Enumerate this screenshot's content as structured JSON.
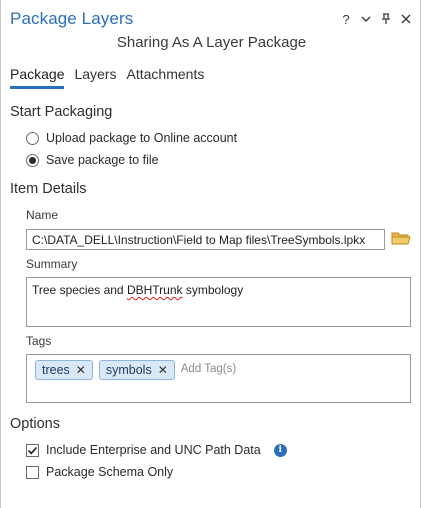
{
  "pane": {
    "title": "Package Layers",
    "controls": {
      "help": "?",
      "menu": "⌄",
      "pin": "⊥",
      "close": "✕"
    },
    "subtitle": "Sharing As A Layer Package"
  },
  "tabs": [
    {
      "label": "Package",
      "active": true
    },
    {
      "label": "Layers",
      "active": false
    },
    {
      "label": "Attachments",
      "active": false
    }
  ],
  "start_packaging": {
    "heading": "Start Packaging",
    "options": [
      {
        "label": "Upload package to Online account",
        "selected": false
      },
      {
        "label": "Save package to file",
        "selected": true
      }
    ]
  },
  "item_details": {
    "heading": "Item Details",
    "name_label": "Name",
    "name_value": "C:\\DATA_DELL\\Instruction\\Field to Map files\\TreeSymbols.lpkx",
    "summary_label": "Summary",
    "summary_before": "Tree species and ",
    "summary_misspelled": "DBHTrunk",
    "summary_after": " symbology",
    "tags_label": "Tags",
    "tags": [
      "trees",
      "symbols"
    ],
    "add_tag_placeholder": "Add Tag(s)"
  },
  "options": {
    "heading": "Options",
    "checkboxes": [
      {
        "label": "Include Enterprise and UNC Path Data",
        "checked": true
      },
      {
        "label": "Package Schema Only",
        "checked": false
      }
    ]
  },
  "colors": {
    "accent": "#2a6fbb",
    "tag_bg": "#d9e8f7",
    "folder": "#e8b84a"
  }
}
